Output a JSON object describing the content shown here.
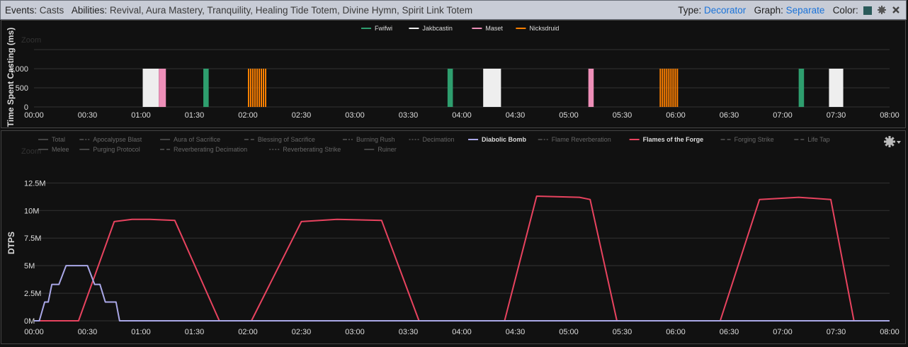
{
  "header": {
    "events_label": "Events:",
    "events_value": "Casts",
    "abilities_label": "Abilities:",
    "abilities_value": "Revival, Aura Mastery, Tranquility, Healing Tide Totem, Divine Hymn, Spirit Link Totem",
    "type_label": "Type:",
    "type_value": "Decorator",
    "graph_label": "Graph:",
    "graph_value": "Separate",
    "color_label": "Color:",
    "color_swatch": "#2a5a5a",
    "gear_icon": "gear-icon"
  },
  "zoom_label": "Zoom",
  "chart_data": [
    {
      "type": "bar",
      "ylabel": "Time Spent Casting (ms)",
      "xlim": [
        0,
        480
      ],
      "ylim": [
        0,
        1000
      ],
      "x_ticks": [
        "00:00",
        "00:30",
        "01:00",
        "01:30",
        "02:00",
        "02:30",
        "03:00",
        "03:30",
        "04:00",
        "04:30",
        "05:00",
        "05:30",
        "06:00",
        "06:30",
        "07:00",
        "07:30",
        "08:00"
      ],
      "y_ticks": [
        "0",
        "500",
        "1,000"
      ],
      "grid": true,
      "legend_position": "top-center",
      "series": [
        {
          "name": "Fwifwi",
          "color": "#2e9e6e",
          "casts": [
            [
              95,
              98
            ],
            [
              232,
              235
            ],
            [
              429,
              432
            ]
          ]
        },
        {
          "name": "Jakbcastin",
          "color": "#eeeeee",
          "casts": [
            [
              61,
              70
            ],
            [
              252,
              262
            ],
            [
              446,
              454
            ]
          ]
        },
        {
          "name": "Maset",
          "color": "#ee8fb8",
          "casts": [
            [
              70,
              74
            ],
            [
              311,
              314
            ]
          ]
        },
        {
          "name": "Nicksdruid",
          "color": "#ff8000",
          "casts": [
            [
              120,
              130
            ],
            [
              351,
              361
            ]
          ]
        }
      ]
    },
    {
      "type": "line",
      "ylabel": "DTPS",
      "xlim": [
        0,
        480
      ],
      "ylim": [
        0,
        14000000
      ],
      "x_ticks": [
        "00:00",
        "00:30",
        "01:00",
        "01:30",
        "02:00",
        "02:30",
        "03:00",
        "03:30",
        "04:00",
        "04:30",
        "05:00",
        "05:30",
        "06:00",
        "06:30",
        "07:00",
        "07:30",
        "08:00"
      ],
      "y_ticks": [
        "0M",
        "2.5M",
        "5M",
        "7.5M",
        "10M",
        "12.5M"
      ],
      "grid": true,
      "legend_position": "top-left",
      "legend": [
        {
          "name": "Total",
          "dash": "solid",
          "active": false
        },
        {
          "name": "Apocalypse Blast",
          "dash": "dashdot",
          "active": false
        },
        {
          "name": "Aura of Sacrifice",
          "dash": "solid",
          "active": false
        },
        {
          "name": "Blessing of Sacrifice",
          "dash": "dashed",
          "active": false
        },
        {
          "name": "Burning Rush",
          "dash": "dashdot",
          "active": false
        },
        {
          "name": "Decimation",
          "dash": "dotted",
          "active": false
        },
        {
          "name": "Diabolic Bomb",
          "dash": "solid",
          "active": true,
          "color": "#aaa8e8"
        },
        {
          "name": "Flame Reverberation",
          "dash": "dashdot",
          "active": false
        },
        {
          "name": "Flames of the Forge",
          "dash": "solid",
          "active": true,
          "color": "#e8435f"
        },
        {
          "name": "Forging Strike",
          "dash": "dashed",
          "active": false
        },
        {
          "name": "Life Tap",
          "dash": "dashed",
          "active": false
        },
        {
          "name": "Melee",
          "dash": "solid",
          "active": false
        },
        {
          "name": "Purging Protocol",
          "dash": "solid",
          "active": false
        },
        {
          "name": "Reverberating Decimation",
          "dash": "dashed",
          "active": false
        },
        {
          "name": "Reverberating Strike",
          "dash": "dotted",
          "active": false
        },
        {
          "name": "Ruiner",
          "dash": "solid",
          "active": false
        }
      ],
      "series": [
        {
          "name": "Flames of the Forge",
          "color": "#e8435f",
          "x": [
            0,
            25,
            45,
            55,
            65,
            79,
            104,
            122,
            150,
            170,
            195,
            216,
            242,
            264,
            282,
            306,
            312,
            327,
            339,
            356,
            385,
            407,
            429,
            447,
            460,
            480
          ],
          "y": [
            0,
            0,
            9000000,
            9200000,
            9200000,
            9100000,
            0,
            0,
            9000000,
            9200000,
            9100000,
            0,
            0,
            0,
            11300000,
            11200000,
            11000000,
            0,
            0,
            0,
            0,
            11000000,
            11200000,
            11000000,
            0,
            0
          ]
        },
        {
          "name": "Diabolic Bomb",
          "color": "#aaa8e8",
          "x": [
            0,
            3,
            6,
            8,
            10,
            14,
            18,
            22,
            30,
            34,
            37,
            40,
            44,
            46,
            48,
            50,
            52,
            55,
            58,
            60,
            62,
            64,
            68,
            73,
            76,
            79,
            82,
            83,
            84,
            100,
            110,
            114,
            118,
            122,
            125,
            128,
            133,
            136,
            141,
            148,
            153,
            159,
            166,
            170,
            172,
            179,
            185,
            189,
            193,
            195,
            197,
            199,
            203,
            205,
            209,
            213,
            217,
            221,
            225,
            228,
            231,
            235,
            245,
            254,
            258,
            264,
            271,
            276,
            278,
            282,
            285,
            290,
            293,
            297,
            301,
            309,
            313,
            318,
            325,
            334,
            354,
            369,
            373,
            384,
            401,
            415,
            417,
            425,
            430,
            445,
            455,
            458,
            462,
            466,
            472,
            480
          ],
          "y": [
            0,
            0,
            1700000,
            1700000,
            3300000,
            3300000,
            5000000,
            5000000,
            5000000,
            3300000,
            3300000,
            1700000,
            1700000,
            1700000,
            0,
            0,
            0,
            0,
            0,
            0,
            0,
            0,
            0,
            0,
            0,
            0,
            0,
            0,
            0,
            0,
            0,
            0,
            0,
            0,
            0,
            0,
            0,
            0,
            0,
            0,
            0,
            0,
            0,
            0,
            0,
            0,
            0,
            0,
            0,
            0,
            0,
            0,
            0,
            0,
            0,
            0,
            0,
            0,
            0,
            0,
            0,
            0,
            0,
            0,
            0,
            0,
            0,
            0,
            0,
            0,
            0,
            0,
            0,
            0,
            0,
            0,
            0,
            0,
            0,
            0,
            0,
            0,
            0,
            0,
            0,
            0,
            0,
            0,
            0,
            0,
            0,
            0,
            0,
            0,
            0,
            0
          ]
        }
      ]
    }
  ]
}
